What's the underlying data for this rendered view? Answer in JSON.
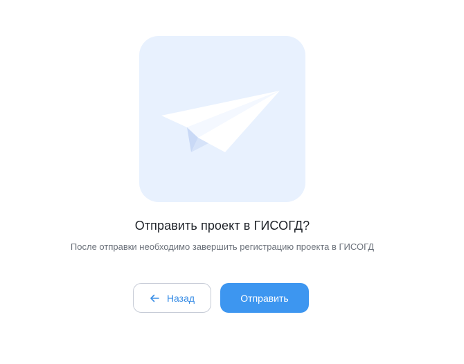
{
  "dialog": {
    "title": "Отправить проект в ГИСОГД?",
    "subtitle": "После отправки необходимо завершить регистрацию проекта в ГИСОГД",
    "illustration_icon": "paper-plane-icon",
    "back_icon": "arrow-left-icon",
    "back_label": "Назад",
    "send_label": "Отправить"
  },
  "colors": {
    "accent": "#3d96f0",
    "illustration_bg": "#e8f1fe",
    "title_text": "#1f2329",
    "subtitle_text": "#6b717a",
    "back_border": "#c6cbd6"
  }
}
